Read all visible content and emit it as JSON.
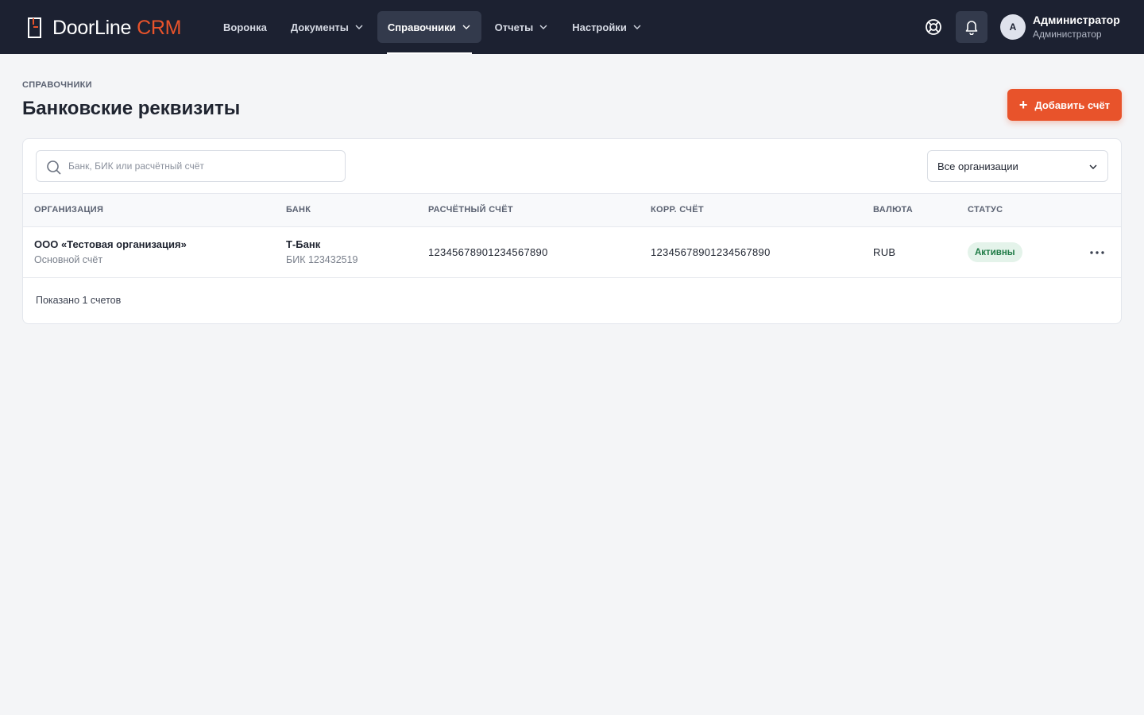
{
  "brand": {
    "name": "DoorLine",
    "suffix": "CRM",
    "accent": "#e8532b",
    "bar_bg": "#1c2131"
  },
  "nav": {
    "items": [
      {
        "label": "Воронка",
        "has_dropdown": false,
        "active": false
      },
      {
        "label": "Документы",
        "has_dropdown": true,
        "active": false
      },
      {
        "label": "Справочники",
        "has_dropdown": true,
        "active": true
      },
      {
        "label": "Отчеты",
        "has_dropdown": true,
        "active": false
      },
      {
        "label": "Настройки",
        "has_dropdown": true,
        "active": false
      }
    ]
  },
  "header_icons": {
    "help": "lifebuoy-icon",
    "notifications": "bell-icon"
  },
  "user": {
    "initial": "А",
    "name": "Администратор",
    "role": "Администратор"
  },
  "page": {
    "breadcrumb": "СПРАВОЧНИКИ",
    "title": "Банковские реквизиты",
    "add_button": "Добавить счёт"
  },
  "filters": {
    "search_placeholder": "Банк, БИК или расчётный счёт",
    "search_value": "",
    "org_select": "Все организации"
  },
  "table": {
    "columns": [
      "ОРГАНИЗАЦИЯ",
      "БАНК",
      "РАСЧЁТНЫЙ СЧЁТ",
      "КОРР. СЧЁТ",
      "ВАЛЮТА",
      "СТАТУС"
    ],
    "rows": [
      {
        "org": "ООО «Тестовая организация»",
        "org_sub": "Основной счёт",
        "bank": "Т-Банк",
        "bik": "БИК 123432519",
        "account": "12345678901234567890",
        "corr_account": "12345678901234567890",
        "currency": "RUB",
        "status": "Активны",
        "status_color": "#1e7a45"
      }
    ]
  },
  "footer": {
    "shown": "Показано 1 счетов"
  }
}
